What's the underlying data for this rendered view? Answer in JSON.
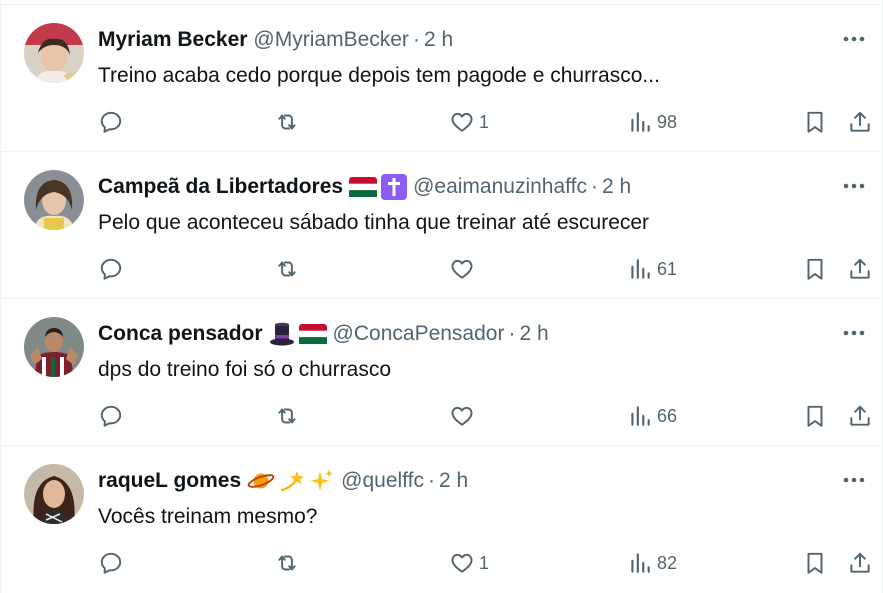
{
  "tweets": [
    {
      "name": "Myriam Becker",
      "handle": "@MyriamBecker",
      "separator": "·",
      "time": "2 h",
      "text": "Treino acaba cedo porque depois tem pagode e churrasco...",
      "likes": "1",
      "views": "98",
      "emojis": []
    },
    {
      "name": "Campeã da Libertadores",
      "handle": "@eaimanuzinhaffc",
      "separator": "·",
      "time": "2 h",
      "text": "Pelo que aconteceu sábado tinha que treinar até escurecer",
      "likes": "",
      "views": "61",
      "emojis": [
        "tricolor-flag-icon",
        "latin-cross-icon"
      ]
    },
    {
      "name": "Conca pensador",
      "handle": "@ConcaPensador",
      "separator": "·",
      "time": "2 h",
      "text": "dps do treino foi só o churrasco",
      "likes": "",
      "views": "66",
      "emojis": [
        "top-hat-icon",
        "tricolor-flag-icon"
      ]
    },
    {
      "name": "raqueL gomes",
      "handle": "@quelffc",
      "separator": "·",
      "time": "2 h",
      "text": "Vocês treinam mesmo?",
      "likes": "1",
      "views": "82",
      "emojis": [
        "ringed-planet-icon",
        "dizzy-icon",
        "sparkles-icon"
      ]
    }
  ],
  "colors": {
    "text": "#0f1419",
    "secondary": "#536471",
    "divider": "#eff3f4",
    "flag_red": "#c8102e",
    "flag_green": "#0a6b3b",
    "cross_purple": "#8b5cf6"
  }
}
